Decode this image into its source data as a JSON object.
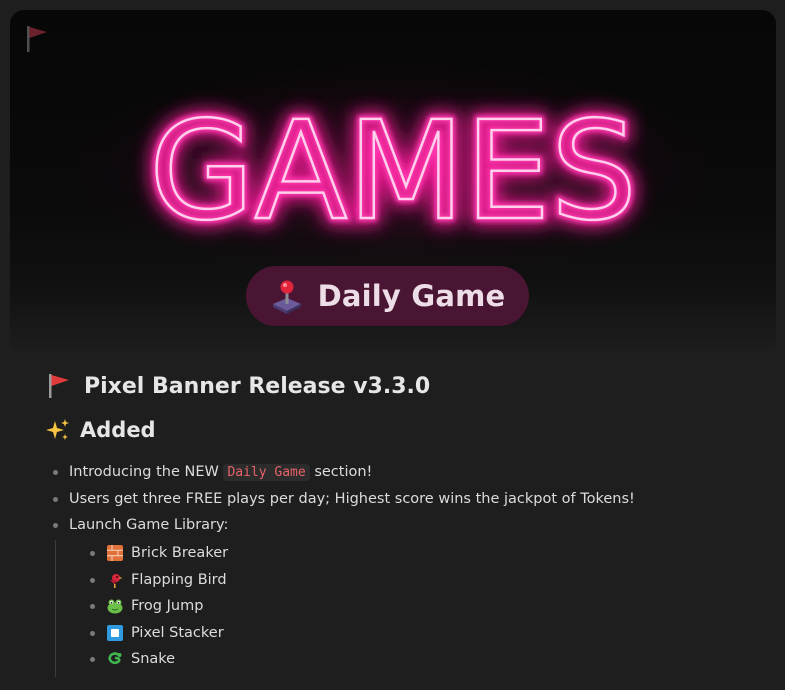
{
  "banner": {
    "neon_text": "GAMES",
    "pill_label": "Daily Game"
  },
  "release": {
    "title": "Pixel Banner Release v3.3.0",
    "added_heading": "Added",
    "items": [
      {
        "before": "Introducing the NEW ",
        "code": "Daily Game",
        "after": " section!"
      },
      {
        "text": "Users get three FREE plays per day; Highest score wins the jackpot of Tokens!"
      },
      {
        "text": "Launch Game Library:"
      }
    ],
    "games": [
      {
        "label": "Brick Breaker",
        "icon": "brick-icon"
      },
      {
        "label": "Flapping Bird",
        "icon": "bird-icon"
      },
      {
        "label": "Frog Jump",
        "icon": "frog-icon"
      },
      {
        "label": "Pixel Stacker",
        "icon": "blue-square-icon"
      },
      {
        "label": "Snake",
        "icon": "snake-icon"
      }
    ]
  },
  "colors": {
    "neon": "#ff2aa5",
    "pill_bg": "#4a1533",
    "code_text": "#e9636a",
    "page_bg": "#1e1e1e"
  }
}
